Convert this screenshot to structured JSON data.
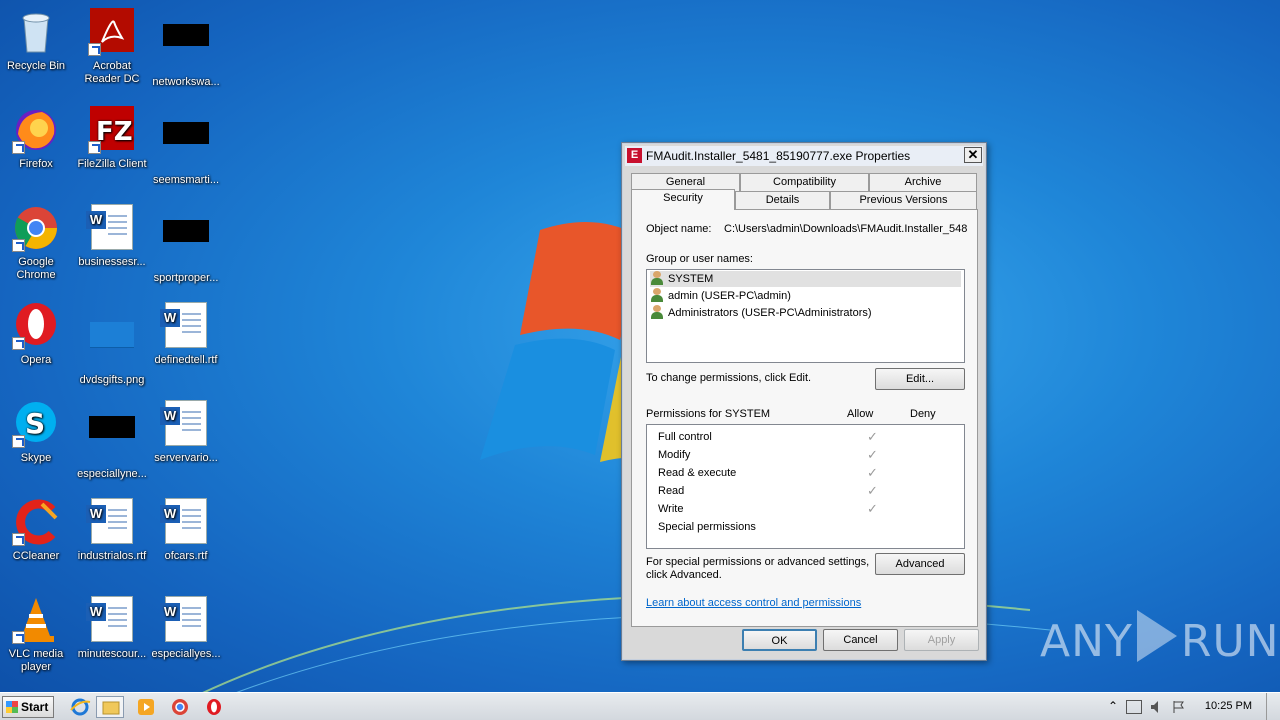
{
  "desktop": {
    "icons": [
      {
        "label": "Recycle Bin"
      },
      {
        "label": "Acrobat Reader DC"
      },
      {
        "label": "networkswa..."
      },
      {
        "label": "Firefox"
      },
      {
        "label": "FileZilla Client"
      },
      {
        "label": "seemsmarti..."
      },
      {
        "label": "Google Chrome"
      },
      {
        "label": "businessesr..."
      },
      {
        "label": "sportproper..."
      },
      {
        "label": "Opera"
      },
      {
        "label": "dvdsgifts.png"
      },
      {
        "label": "definedtell.rtf"
      },
      {
        "label": "Skype"
      },
      {
        "label": "especiallyne..."
      },
      {
        "label": "servervario..."
      },
      {
        "label": "CCleaner"
      },
      {
        "label": "industrialos.rtf"
      },
      {
        "label": "ofcars.rtf"
      },
      {
        "label": "VLC media player"
      },
      {
        "label": "minutescour..."
      },
      {
        "label": "especiallyes..."
      }
    ]
  },
  "dialog": {
    "title": "FMAudit.Installer_5481_85190777.exe Properties",
    "title_icon": "E",
    "close_label": "✕",
    "tabs_row1": [
      "General",
      "Compatibility",
      "Archive"
    ],
    "tabs_row2": [
      "Security",
      "Details",
      "Previous Versions"
    ],
    "object_name_label": "Object name:",
    "object_name_value": "C:\\Users\\admin\\Downloads\\FMAudit.Installer_548",
    "group_label": "Group or user names:",
    "users": [
      {
        "name": "SYSTEM"
      },
      {
        "name": "admin (USER-PC\\admin)"
      },
      {
        "name": "Administrators (USER-PC\\Administrators)"
      }
    ],
    "change_text": "To change permissions, click Edit.",
    "edit_button": "Edit...",
    "permissions_for": "Permissions for SYSTEM",
    "allow_header": "Allow",
    "deny_header": "Deny",
    "permissions": [
      {
        "name": "Full control",
        "allow": "✓"
      },
      {
        "name": "Modify",
        "allow": "✓"
      },
      {
        "name": "Read & execute",
        "allow": "✓"
      },
      {
        "name": "Read",
        "allow": "✓"
      },
      {
        "name": "Write",
        "allow": "✓"
      },
      {
        "name": "Special permissions",
        "allow": ""
      }
    ],
    "advanced_text_1": "For special permissions or advanced settings,",
    "advanced_text_2": "click Advanced.",
    "advanced_button": "Advanced",
    "learn_link": "Learn about access control and permissions",
    "ok_button": "OK",
    "cancel_button": "Cancel",
    "apply_button": "Apply"
  },
  "watermark": {
    "left": "ANY",
    "right": "RUN"
  },
  "taskbar": {
    "start_label": "Start",
    "clock": "10:25 PM",
    "tray_arrow": "⌃"
  }
}
